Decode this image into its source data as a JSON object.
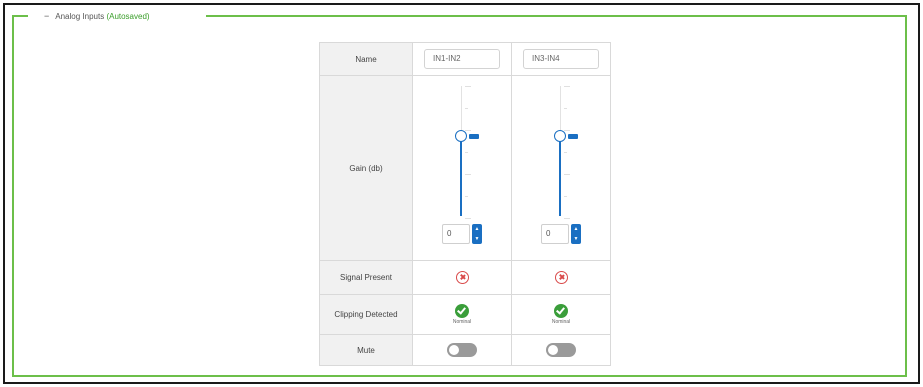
{
  "panel": {
    "collapse_symbol": "−",
    "title": "Analog Inputs",
    "status": "(Autosaved)"
  },
  "table": {
    "rows": {
      "name": "Name",
      "gain": "Gain (db)",
      "signal": "Signal Present",
      "clipping": "Clipping Detected",
      "mute": "Mute"
    },
    "channels": [
      {
        "name": "IN1-IN2",
        "gain_value": "0",
        "gain_level": 0.55,
        "signal_present": false,
        "clipping_label": "Nominal",
        "mute": false
      },
      {
        "name": "IN3-IN4",
        "gain_value": "0",
        "gain_level": 0.55,
        "signal_present": false,
        "clipping_label": "Nominal",
        "mute": false
      }
    ]
  },
  "icons": {
    "signal_absent": "x-circle-icon",
    "clipping_ok": "check-circle-icon",
    "spin_up": "chevron-up-icon",
    "spin_down": "chevron-down-icon"
  },
  "colors": {
    "panel_border": "#6cbf4a",
    "status_text": "#3a9e2a",
    "accent": "#1a6fc2",
    "error": "#d94a4a",
    "success": "#3a9e3a",
    "toggle_off": "#9a9a9a"
  }
}
